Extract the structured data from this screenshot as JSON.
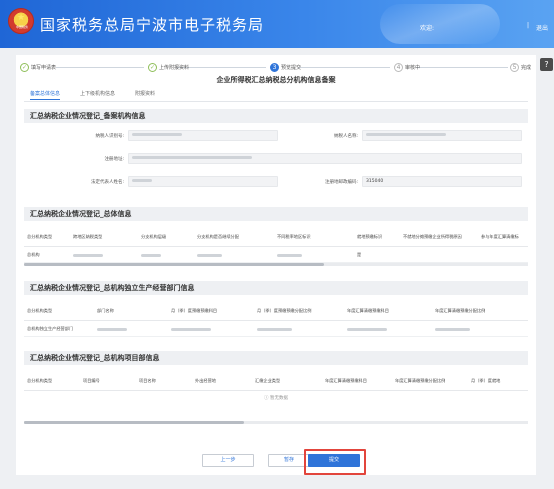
{
  "header": {
    "site_title": "国家税务总局宁波市电子税务局",
    "logo_text": "中国税务",
    "user_label": "欢迎:",
    "separator": "|",
    "logout": "退出"
  },
  "steps": [
    {
      "num": "✓",
      "label": "填写申请表",
      "state": "done"
    },
    {
      "num": "✓",
      "label": "上传附报资料",
      "state": "done"
    },
    {
      "num": "3",
      "label": "预览提交",
      "state": "active"
    },
    {
      "num": "4",
      "label": "审核中",
      "state": "todo"
    },
    {
      "num": "5",
      "label": "完成",
      "state": "todo"
    }
  ],
  "form_title": "企业所得税汇总纳税总分机构信息备案",
  "tabs": [
    "备案总体信息",
    "上下级机构信息",
    "附报资料"
  ],
  "sections": {
    "basic": {
      "title": "汇总纳税企业情况登记_备案机构信息",
      "fields": {
        "taxpayer_id_label": "纳税人识别号:",
        "taxpayer_name_label": "纳税人名称:",
        "reg_address_label": "注册地址:",
        "legal_rep_label": "法定代表人姓名:",
        "postcode_label": "注册地邮政编码:",
        "postcode_value": "315040"
      }
    },
    "overall": {
      "title": "汇总纳税企业情况登记_总体信息",
      "headers": [
        "总分机构类型",
        "跨地区纳税类型",
        "分支机构层级",
        "分支机构是否继续分配",
        "不同税率地区标识",
        "就地预缴标识",
        "不就地分摊预缴企业所得税原因",
        "参与年度汇算清缴标"
      ],
      "rows": [
        [
          "总机构",
          "",
          "",
          "",
          "",
          "是",
          "",
          ""
        ]
      ]
    },
    "dept": {
      "title": "汇总纳税企业情况登记_总机构独立生产经营部门信息",
      "headers": [
        "总分机构类型",
        "部门名称",
        "月（季）度预缴预缴科目",
        "月（季）度预缴预缴分配比例",
        "年度汇算清缴预缴科目",
        "年度汇算清缴预缴分配比例"
      ],
      "rows": [
        [
          "总机构独立生产经营部门",
          "",
          "",
          "",
          "",
          ""
        ]
      ]
    },
    "project": {
      "title": "汇总纳税企业情况登记_总机构项目部信息",
      "headers": [
        "总分机构类型",
        "项目编号",
        "项目名称",
        "外出经营地",
        "汇缴企业类型",
        "年度汇算清缴预缴科目",
        "年度汇算清缴预缴分配比例",
        "月（季）度就地"
      ],
      "empty_text": "暂无数据"
    }
  },
  "buttons": {
    "prev": "上一步",
    "save": "暂存",
    "submit": "提交"
  },
  "side_icon": "help-icon",
  "colors": {
    "brand": "#2f74d9",
    "header": "#1f66d6",
    "highlight": "#e2453c",
    "step_done": "#8fbf5a"
  }
}
